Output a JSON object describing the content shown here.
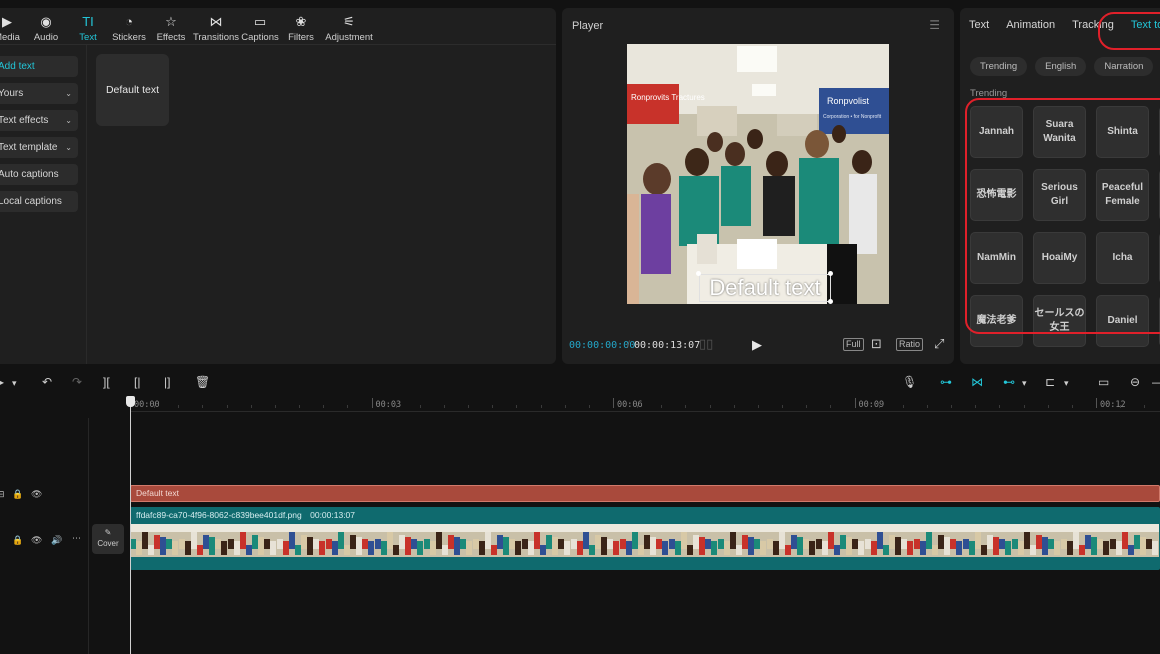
{
  "toolbar": {
    "items": [
      {
        "label": "Media",
        "icon": "media-icon",
        "glyph": "▶"
      },
      {
        "label": "Audio",
        "icon": "audio-icon",
        "glyph": "◉"
      },
      {
        "label": "Text",
        "icon": "text-icon",
        "glyph": "TI"
      },
      {
        "label": "Stickers",
        "icon": "stickers-icon",
        "glyph": "◔"
      },
      {
        "label": "Effects",
        "icon": "effects-icon",
        "glyph": "☆"
      },
      {
        "label": "Transitions",
        "icon": "transitions-icon",
        "glyph": "⋈"
      },
      {
        "label": "Captions",
        "icon": "captions-icon",
        "glyph": "▭"
      },
      {
        "label": "Filters",
        "icon": "filters-icon",
        "glyph": "❀"
      },
      {
        "label": "Adjustment",
        "icon": "adjustment-icon",
        "glyph": "⚟"
      }
    ],
    "active": "Text"
  },
  "side_menu": [
    {
      "label": "Add text",
      "chevron": false,
      "active": true
    },
    {
      "label": "Yours",
      "chevron": true
    },
    {
      "label": "Text effects",
      "chevron": true
    },
    {
      "label": "Text template",
      "chevron": true
    },
    {
      "label": "Auto captions",
      "chevron": false
    },
    {
      "label": "Local captions",
      "chevron": false
    }
  ],
  "default_text_card": "Default text",
  "player": {
    "title": "Player",
    "overlay_text": "Default text",
    "time_current": "00:00:00:00",
    "time_separator": "/",
    "time_total": "00:00:13:07",
    "controls": [
      "Full",
      "Ratio"
    ],
    "scene": {
      "left_banner": "Ronprovits Tractures",
      "right_banner": "Ronpvolist",
      "right_banner_sub": "Corporation • for Nonprofit"
    }
  },
  "right_panel": {
    "tabs": [
      "Text",
      "Animation",
      "Tracking",
      "Text to speech"
    ],
    "active_tab": "Text to speech",
    "chips": [
      "Trending",
      "English",
      "Narration"
    ],
    "section_label": "Trending",
    "voices": [
      [
        "Jannah",
        "Suara Wanita",
        "Shinta"
      ],
      [
        "恐怖電影",
        "Serious Girl",
        "Peaceful Female"
      ],
      [
        "NamMin",
        "HoaiMy",
        "Icha"
      ],
      [
        "魔法老爹",
        "セールスの女王",
        "Daniel"
      ]
    ]
  },
  "timeline": {
    "ruler_labels": [
      "00:00",
      "00:03",
      "00:06",
      "00:09",
      "00:12"
    ],
    "text_clip_label": "Default text",
    "video_clip_name": "ffdafc89-ca70-4f96-8062-c839bee401df.png",
    "video_clip_duration": "00:00:13:07",
    "cover_label": "Cover"
  },
  "colors": {
    "accent": "#23c6d8",
    "text_clip": "#a94a3c",
    "video_clip": "#0f6a6e",
    "highlight": "#e0202a"
  }
}
